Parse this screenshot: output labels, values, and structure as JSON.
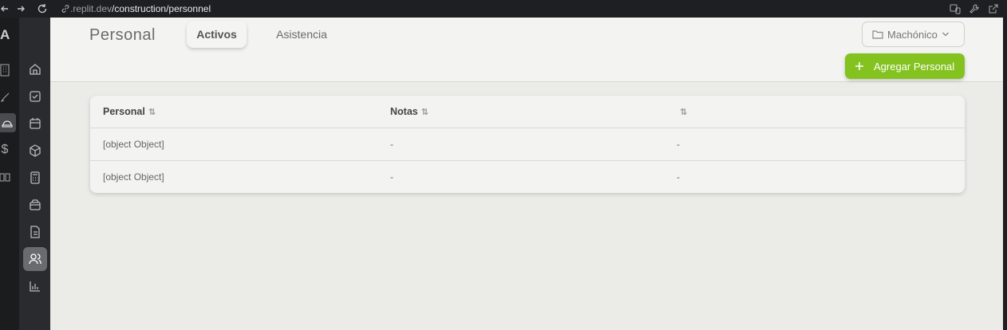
{
  "browser": {
    "url_host": ".replit.dev",
    "url_path": "/construction/personnel"
  },
  "rail": {
    "logo": "A"
  },
  "header": {
    "title": "Personal",
    "tabs": [
      {
        "label": "Activos",
        "active": true
      },
      {
        "label": "Asistencia",
        "active": false
      }
    ],
    "project_select": "Machónico",
    "add_button": "Agregar Personal"
  },
  "table": {
    "columns": [
      "Personal",
      "Notas",
      ""
    ],
    "sort_glyph": "⇅",
    "rows": [
      [
        "[object Object]",
        "-",
        "-"
      ],
      [
        "[object Object]",
        "-",
        "-"
      ]
    ]
  },
  "colors": {
    "accent": "#84c21f",
    "sidebar": "#2a2b2e",
    "content_bg": "#ebebe7"
  }
}
